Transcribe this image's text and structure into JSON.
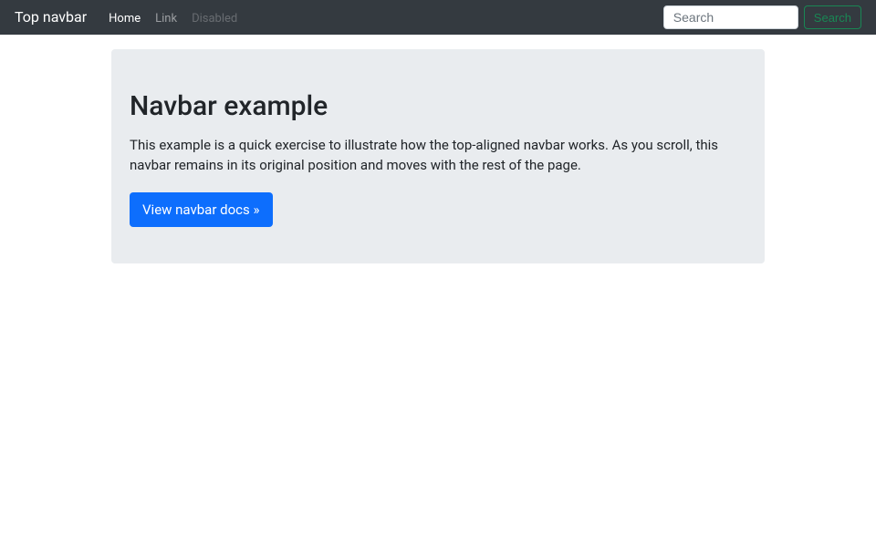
{
  "navbar": {
    "brand": "Top navbar",
    "links": [
      {
        "label": "Home"
      },
      {
        "label": "Link"
      },
      {
        "label": "Disabled"
      }
    ],
    "search": {
      "placeholder": "Search",
      "button": "Search"
    }
  },
  "main": {
    "heading": "Navbar example",
    "body": "This example is a quick exercise to illustrate how the top-aligned navbar works. As you scroll, this navbar remains in its original position and moves with the rest of the page.",
    "cta": "View navbar docs »"
  }
}
